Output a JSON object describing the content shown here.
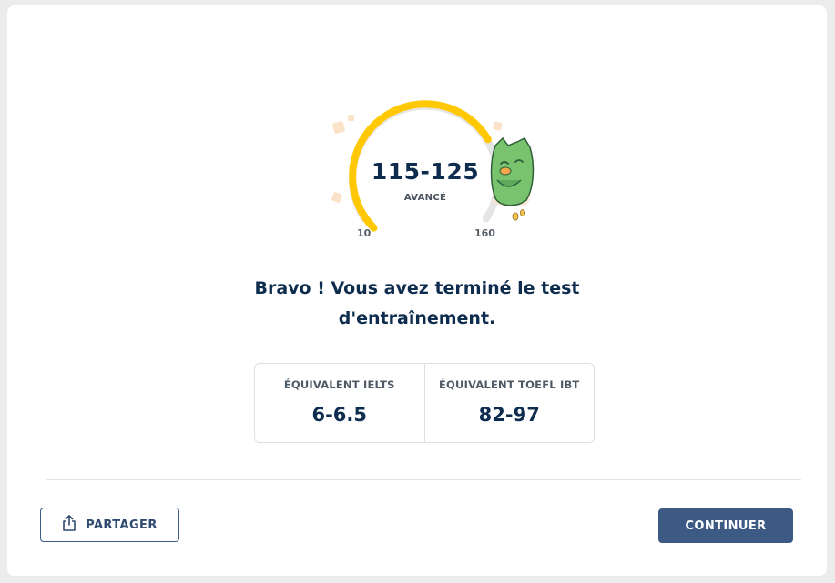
{
  "result": {
    "score_range": "115-125",
    "level": "AVANCÉ",
    "scale_min": "10",
    "scale_max": "160",
    "progress_fraction": 0.72
  },
  "message": {
    "line1": "Bravo ! Vous avez terminé le test",
    "line2": "d'entraînement."
  },
  "equivalents": [
    {
      "label": "ÉQUIVALENT IELTS",
      "value": "6-6.5"
    },
    {
      "label": "ÉQUIVALENT TOEFL IBT",
      "value": "82-97"
    }
  ],
  "buttons": {
    "share_label": "PARTAGER",
    "continue_label": "CONTINUER"
  },
  "icons": {
    "share": "share-icon",
    "mascot": "owl-mascot-icon"
  },
  "colors": {
    "gauge_fill": "#ffc800",
    "gauge_track": "#e5e5e5",
    "primary": "#3c5a84",
    "text_dark": "#0e2d4e"
  }
}
